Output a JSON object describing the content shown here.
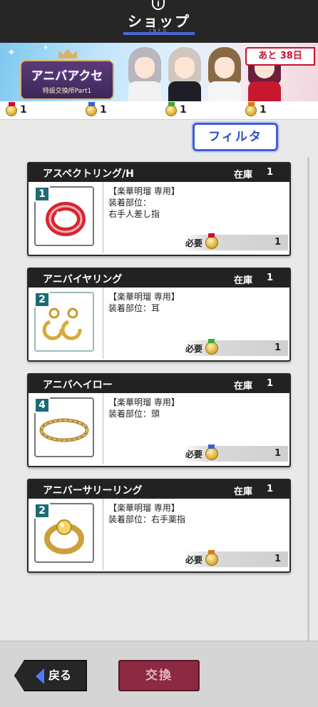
{
  "header": {
    "title": "ショップ",
    "subtitle": "INFO",
    "info_icon_glyph": "i"
  },
  "banner": {
    "logo_main": "アニバアクセ",
    "logo_sub": "特設交換所Part1",
    "days_left": "あと 38日"
  },
  "currency": [
    {
      "count": "1",
      "ribbon": "#c8102e"
    },
    {
      "count": "1",
      "ribbon": "#3f5fd4"
    },
    {
      "count": "1",
      "ribbon": "#3aa83a"
    },
    {
      "count": "1",
      "ribbon": "#e07a10"
    }
  ],
  "filter_label": "フィルタ",
  "stock_label": "在庫",
  "need_label": "必要",
  "items": [
    {
      "name": "アスペクトリング/H",
      "stock": "1",
      "rank": "1",
      "owner": "【楽華明瑠 専用】",
      "slot": "装着部位：",
      "slot2": "右手人差し指",
      "need": "1",
      "icon": "red-ring-icon",
      "coin_ribbon": "#c8102e"
    },
    {
      "name": "アニバイヤリング",
      "stock": "1",
      "rank": "2",
      "owner": "【楽華明瑠 専用】",
      "slot": "装着部位：耳",
      "slot2": "",
      "need": "1",
      "icon": "earrings-icon",
      "coin_ribbon": "#3aa83a"
    },
    {
      "name": "アニバヘイロー",
      "stock": "1",
      "rank": "4",
      "owner": "【楽華明瑠 専用】",
      "slot": "装着部位：頭",
      "slot2": "",
      "need": "1",
      "icon": "halo-icon",
      "coin_ribbon": "#3f5fd4"
    },
    {
      "name": "アニバーサリーリング",
      "stock": "1",
      "rank": "2",
      "owner": "【楽華明瑠 専用】",
      "slot": "装着部位：右手薬指",
      "slot2": "",
      "need": "1",
      "icon": "gold-ring-icon",
      "coin_ribbon": "#e07a10"
    }
  ],
  "footer": {
    "back_label": "戻る",
    "exchange_label": "交換"
  }
}
